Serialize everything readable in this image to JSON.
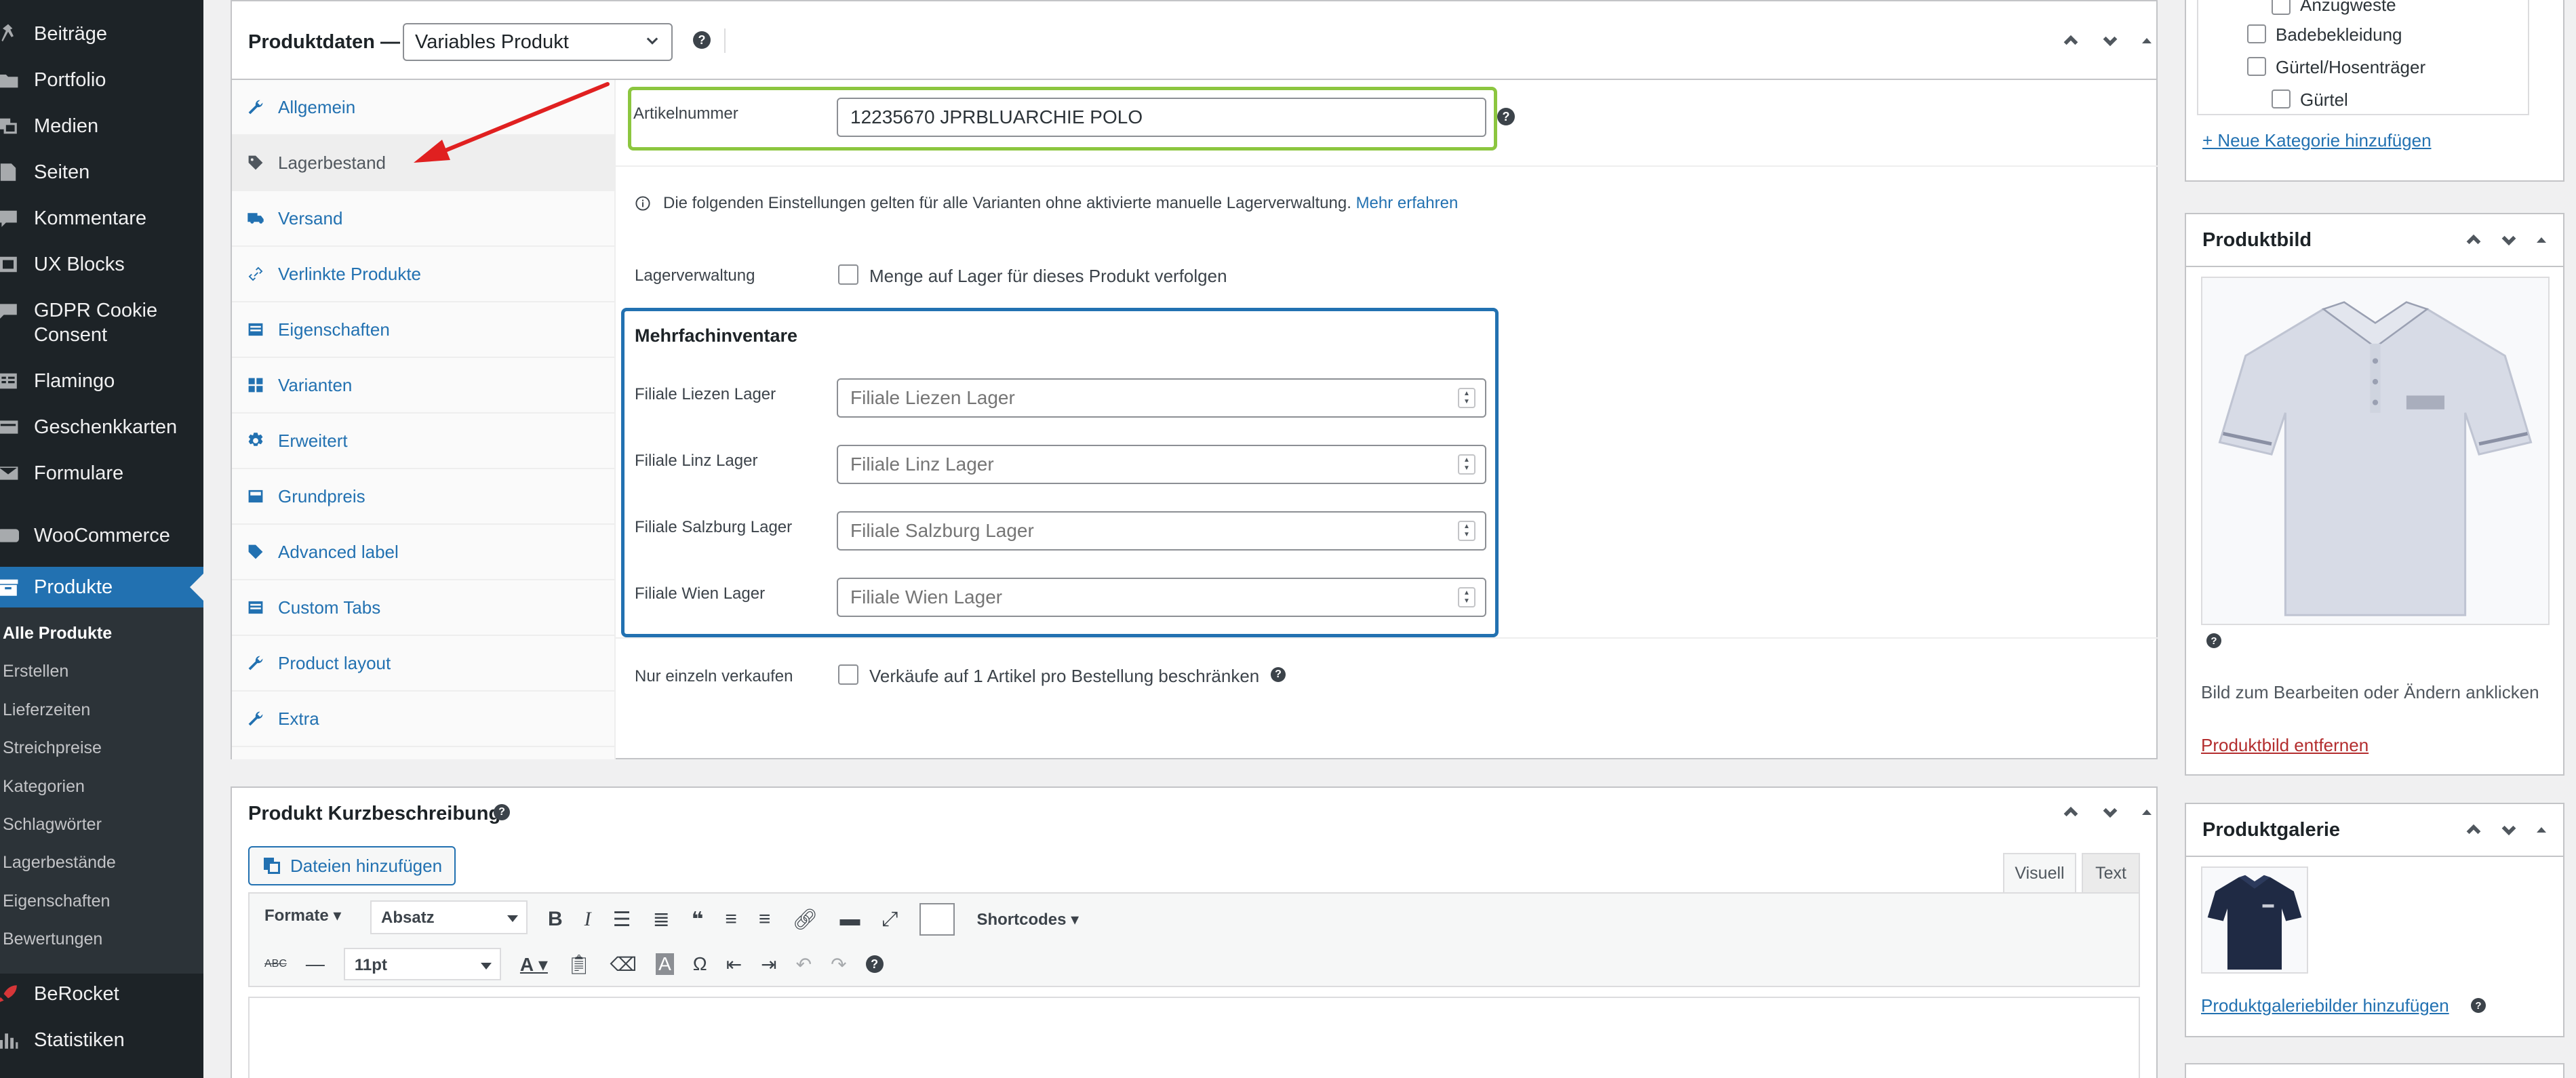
{
  "menu": {
    "items": [
      {
        "label": "Beiträge",
        "icon": "pin-icon"
      },
      {
        "label": "Portfolio",
        "icon": "folder-icon"
      },
      {
        "label": "Medien",
        "icon": "media-icon"
      },
      {
        "label": "Seiten",
        "icon": "page-icon"
      },
      {
        "label": "Kommentare",
        "icon": "comment-icon"
      },
      {
        "label": "UX Blocks",
        "icon": "blocks-icon"
      },
      {
        "label": "GDPR Cookie",
        "label2": "Consent",
        "icon": "cookie-icon"
      },
      {
        "label": "Flamingo",
        "icon": "list-icon"
      },
      {
        "label": "Geschenkkarten",
        "icon": "card-icon"
      },
      {
        "label": "Formulare",
        "icon": "mail-icon"
      },
      {
        "label": "WooCommerce",
        "icon": "woo-icon"
      },
      {
        "label": "Produkte",
        "icon": "archive-icon"
      }
    ],
    "submenu": [
      "Alle Produkte",
      "Erstellen",
      "Lieferzeiten",
      "Streichpreise",
      "Kategorien",
      "Schlagwörter",
      "Lagerbestände",
      "Eigenschaften",
      "Bewertungen"
    ],
    "after": [
      {
        "label": "BeRocket",
        "icon": "rocket-icon"
      },
      {
        "label": "Statistiken",
        "icon": "chart-icon"
      }
    ]
  },
  "product_data": {
    "title": "Produktdaten —",
    "type_select": "Variables Produkt",
    "help": "?",
    "tabs": [
      "Allgemein",
      "Lagerbestand",
      "Versand",
      "Verlinkte Produkte",
      "Eigenschaften",
      "Varianten",
      "Erweitert",
      "Grundpreis",
      "Advanced label",
      "Custom Tabs",
      "Product layout",
      "Extra"
    ],
    "sku_label": "Artikelnummer",
    "sku_value": "12235670 JPRBLUARCHIE POLO",
    "info_text": "Die folgenden Einstellungen gelten für alle Varianten ohne aktivierte manuelle Lagerverwaltung.",
    "info_link": "Mehr erfahren",
    "stock_mgmt_label": "Lagerverwaltung",
    "stock_mgmt_text": "Menge auf Lager für dieses Produkt verfolgen",
    "multi_title": "Mehrfachinventare",
    "inventories": [
      {
        "label": "Filiale Liezen Lager",
        "placeholder": "Filiale Liezen Lager"
      },
      {
        "label": "Filiale Linz Lager",
        "placeholder": "Filiale Linz Lager"
      },
      {
        "label": "Filiale Salzburg Lager",
        "placeholder": "Filiale Salzburg Lager"
      },
      {
        "label": "Filiale Wien Lager",
        "placeholder": "Filiale Wien Lager"
      }
    ],
    "sold_individually_label": "Nur einzeln verkaufen",
    "sold_individually_text": "Verkäufe auf 1 Artikel pro Bestellung beschränken"
  },
  "categories": {
    "items": [
      "Anzugweste",
      "Badebekleidung",
      "Gürtel/Hosenträger",
      "Gürtel"
    ],
    "add_link": "+ Neue Kategorie hinzufügen"
  },
  "product_image": {
    "title": "Produktbild",
    "hint": "Bild zum Bearbeiten oder Ändern anklicken",
    "remove_link": "Produktbild entfernen",
    "help": "?"
  },
  "gallery": {
    "title": "Produktgalerie",
    "add_link": "Produktgaleriebilder hinzufügen",
    "help": "?"
  },
  "short_desc": {
    "title": "Produkt Kurzbeschreibung",
    "help": "?",
    "add_media": "Dateien hinzufügen",
    "tab_visual": "Visuell",
    "tab_text": "Text",
    "formats": "Formate",
    "paragraph": "Absatz",
    "shortcodes": "Shortcodes",
    "font_size": "11pt"
  },
  "colors": {
    "admin_bg": "#1d2327",
    "active": "#2271b1",
    "sku_highlight": "#8cc63f",
    "inventory_highlight": "#2271b1",
    "remove_link": "#b32d2e",
    "annotation_arrow": "#e02020"
  }
}
